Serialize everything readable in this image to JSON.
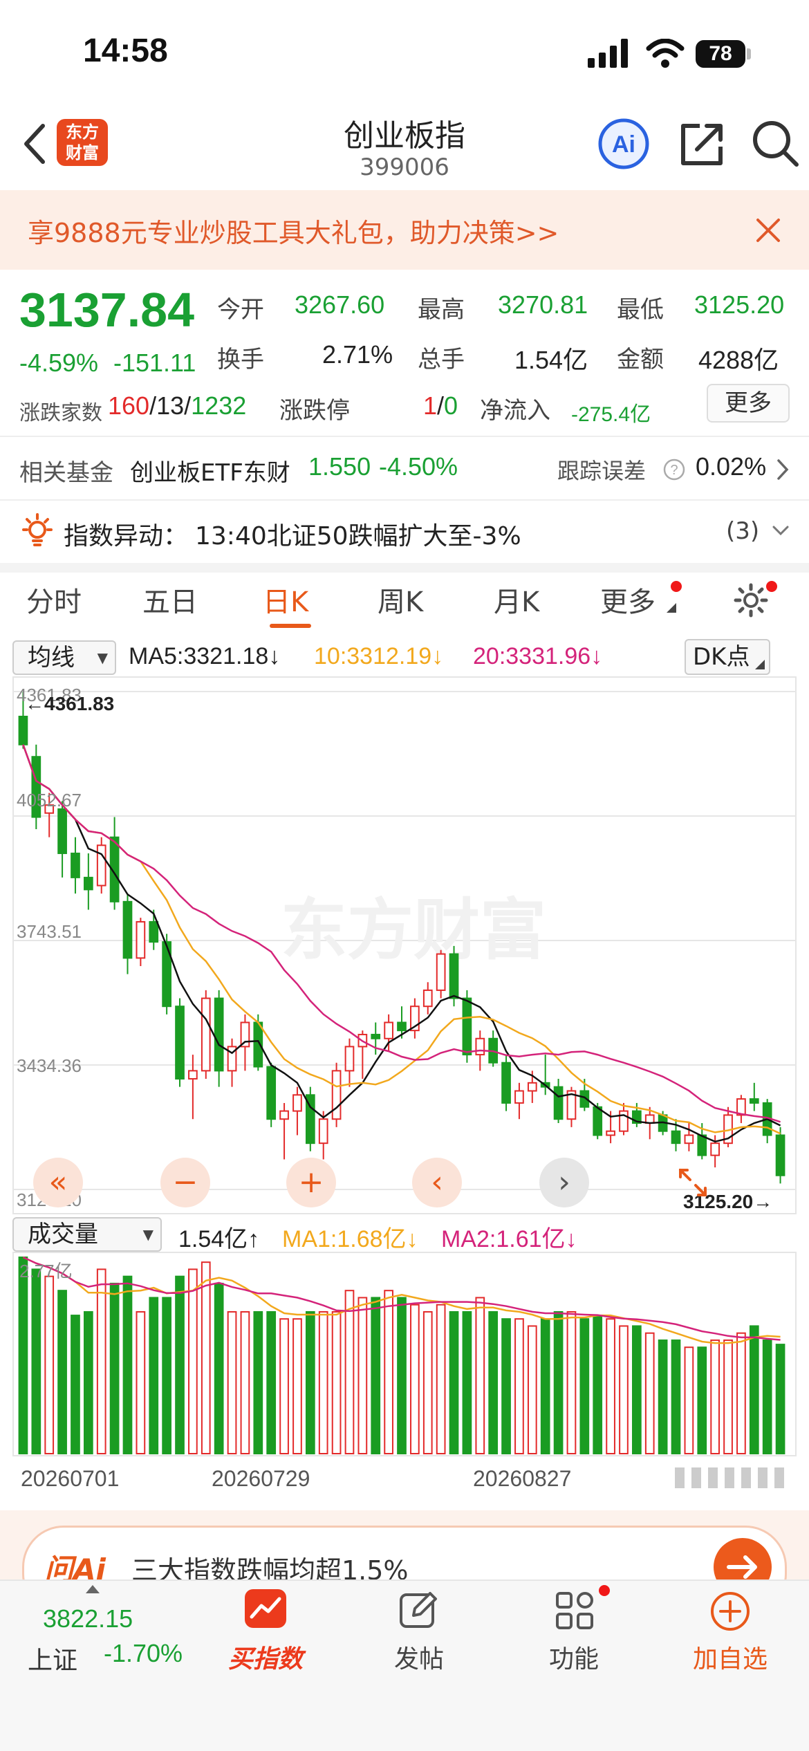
{
  "status": {
    "time": "14:58",
    "battery": "78"
  },
  "nav": {
    "title": "创业板指",
    "code": "399006",
    "logo_text": "东方\n财富"
  },
  "banner": {
    "text": "享9888元专业炒股工具大礼包，助力决策>>"
  },
  "quote": {
    "price": "3137.84",
    "change_pct": "-4.59%",
    "change": "-151.11",
    "open_label": "今开",
    "open": "3267.60",
    "high_label": "最高",
    "high": "3270.81",
    "low_label": "最低",
    "low": "3125.20",
    "turnover_label": "换手",
    "turnover": "2.71%",
    "volume_label": "总手",
    "volume": "1.54亿",
    "amount_label": "金额",
    "amount": "4288亿",
    "breadth_label": "涨跌家数",
    "up": "160",
    "flat": "13",
    "down": "1232",
    "limit_label": "涨跌停",
    "limit_up": "1",
    "limit_down": "0",
    "inflow_label": "净流入",
    "inflow": "-275.4亿",
    "more": "更多"
  },
  "fund": {
    "label": "相关基金",
    "name": "创业板ETF东财",
    "price": "1.550",
    "pct": "-4.50%",
    "err_label": "跟踪误差",
    "err": "0.02%"
  },
  "alert": {
    "label": "指数异动：",
    "text": "13:40北证50跌幅扩大至-3%",
    "count": "(3)"
  },
  "tabs": [
    "分时",
    "五日",
    "日K",
    "周K",
    "月K",
    "更多"
  ],
  "kline": {
    "ma_select": "均线",
    "ma5": "MA5:3321.18↓",
    "ma10": "10:3312.19↓",
    "ma20": "20:3331.96↓",
    "dk": "DK点",
    "y_labels": [
      "4361.83",
      "4052.67",
      "3743.51",
      "3434.36",
      "3125.20"
    ],
    "max_marker": "←4361.83",
    "min_marker": "3125.20→",
    "watermark": "东方财富"
  },
  "volume": {
    "select": "成交量",
    "current": "1.54亿↑",
    "ma1": "MA1:1.68亿↓",
    "ma2": "MA2:1.61亿↓",
    "top_label": "2.77亿",
    "dates": [
      "20260701",
      "20260729",
      "20260827"
    ]
  },
  "ai": {
    "logo": "问Ai",
    "text": "三大指数跌幅均超1.5%"
  },
  "bottom": {
    "index_value": "3822.15",
    "index_name": "上证",
    "index_pct": "-1.70%",
    "buy": "买指数",
    "post": "发帖",
    "func": "功能",
    "add": "加自选"
  },
  "chart_data": {
    "type": "candlestick",
    "ylim": [
      3125.2,
      4361.83
    ],
    "candles": [
      [
        4300,
        4361,
        4220,
        4230
      ],
      [
        4200,
        4230,
        4020,
        4050
      ],
      [
        4060,
        4110,
        4000,
        4080
      ],
      [
        4070,
        4090,
        3900,
        3960
      ],
      [
        3960,
        4000,
        3860,
        3900
      ],
      [
        3900,
        3960,
        3820,
        3870
      ],
      [
        3880,
        4000,
        3860,
        3980
      ],
      [
        4000,
        4050,
        3820,
        3840
      ],
      [
        3840,
        3860,
        3660,
        3700
      ],
      [
        3700,
        3800,
        3680,
        3790
      ],
      [
        3790,
        3820,
        3720,
        3740
      ],
      [
        3740,
        3760,
        3560,
        3580
      ],
      [
        3580,
        3600,
        3380,
        3400
      ],
      [
        3400,
        3460,
        3300,
        3420
      ],
      [
        3420,
        3620,
        3400,
        3600
      ],
      [
        3600,
        3620,
        3380,
        3420
      ],
      [
        3420,
        3500,
        3380,
        3480
      ],
      [
        3480,
        3560,
        3420,
        3540
      ],
      [
        3540,
        3560,
        3420,
        3430
      ],
      [
        3430,
        3440,
        3280,
        3300
      ],
      [
        3300,
        3340,
        3200,
        3320
      ],
      [
        3320,
        3380,
        3260,
        3360
      ],
      [
        3360,
        3380,
        3220,
        3240
      ],
      [
        3240,
        3320,
        3200,
        3300
      ],
      [
        3300,
        3440,
        3280,
        3420
      ],
      [
        3420,
        3500,
        3380,
        3480
      ],
      [
        3480,
        3520,
        3400,
        3510
      ],
      [
        3510,
        3540,
        3460,
        3500
      ],
      [
        3500,
        3560,
        3470,
        3540
      ],
      [
        3540,
        3580,
        3500,
        3520
      ],
      [
        3520,
        3600,
        3500,
        3580
      ],
      [
        3580,
        3640,
        3560,
        3620
      ],
      [
        3620,
        3720,
        3600,
        3710
      ],
      [
        3710,
        3730,
        3580,
        3600
      ],
      [
        3600,
        3620,
        3440,
        3460
      ],
      [
        3460,
        3520,
        3420,
        3500
      ],
      [
        3500,
        3520,
        3430,
        3440
      ],
      [
        3440,
        3460,
        3320,
        3340
      ],
      [
        3340,
        3390,
        3300,
        3370
      ],
      [
        3370,
        3420,
        3340,
        3390
      ],
      [
        3390,
        3460,
        3360,
        3380
      ],
      [
        3380,
        3400,
        3290,
        3300
      ],
      [
        3300,
        3380,
        3280,
        3370
      ],
      [
        3370,
        3400,
        3320,
        3330
      ],
      [
        3330,
        3340,
        3250,
        3260
      ],
      [
        3260,
        3320,
        3240,
        3270
      ],
      [
        3270,
        3340,
        3260,
        3320
      ],
      [
        3320,
        3340,
        3280,
        3290
      ],
      [
        3290,
        3330,
        3250,
        3310
      ],
      [
        3310,
        3320,
        3260,
        3270
      ],
      [
        3270,
        3300,
        3220,
        3240
      ],
      [
        3240,
        3290,
        3220,
        3260
      ],
      [
        3260,
        3290,
        3200,
        3210
      ],
      [
        3210,
        3260,
        3180,
        3240
      ],
      [
        3240,
        3330,
        3230,
        3310
      ],
      [
        3310,
        3360,
        3290,
        3350
      ],
      [
        3350,
        3390,
        3320,
        3340
      ],
      [
        3340,
        3350,
        3240,
        3260
      ],
      [
        3260,
        3280,
        3140,
        3160
      ]
    ],
    "volumes": [
      2.77,
      2.6,
      2.5,
      2.3,
      1.95,
      2.0,
      2.6,
      2.4,
      2.5,
      2.0,
      2.2,
      2.2,
      2.5,
      2.6,
      2.7,
      2.4,
      2.0,
      2.0,
      2.0,
      2.0,
      1.9,
      1.9,
      2.0,
      2.0,
      2.0,
      2.3,
      2.2,
      2.2,
      2.3,
      2.2,
      2.1,
      2.0,
      2.1,
      2.0,
      2.0,
      2.2,
      2.0,
      1.9,
      1.9,
      1.8,
      1.9,
      2.0,
      2.0,
      1.9,
      1.95,
      1.9,
      1.8,
      1.8,
      1.7,
      1.6,
      1.6,
      1.5,
      1.5,
      1.6,
      1.6,
      1.7,
      1.8,
      1.6,
      1.54
    ]
  }
}
